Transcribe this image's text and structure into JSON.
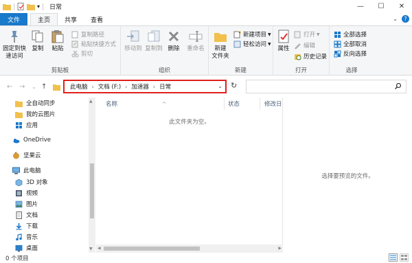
{
  "window": {
    "title": "日常",
    "controls": {
      "minimize": "—",
      "maximize": "☐",
      "close": "✕"
    }
  },
  "ribbon_tabs": [
    {
      "label": "文件"
    },
    {
      "label": "主页"
    },
    {
      "label": "共享"
    },
    {
      "label": "查看"
    }
  ],
  "ribbon": {
    "clipboard": {
      "label": "剪贴板",
      "pin": "固定到快\n速访问",
      "copy": "复制",
      "paste": "粘贴",
      "copy_path": "复制路径",
      "paste_shortcut": "粘贴快捷方式",
      "cut": "剪切"
    },
    "organize": {
      "label": "组织",
      "move_to": "移动到",
      "copy_to": "复制到",
      "delete": "删除",
      "rename": "重命名"
    },
    "new": {
      "label": "新建",
      "new_folder": "新建\n文件夹",
      "new_item": "新建项目",
      "easy_access": "轻松访问"
    },
    "open": {
      "label": "打开",
      "properties": "属性",
      "open": "打开",
      "edit": "编辑",
      "history": "历史记录"
    },
    "select": {
      "label": "选择",
      "select_all": "全部选择",
      "select_none": "全部取消",
      "invert": "反向选择"
    }
  },
  "address": {
    "crumbs": [
      "此电脑",
      "文档 (F:)",
      "加速器",
      "日常"
    ],
    "dropdown_glyph": "⌄",
    "refresh_glyph": "↻"
  },
  "nav_glyphs": {
    "back": "←",
    "forward": "→",
    "recent": "⌄",
    "up": "↑"
  },
  "navpane": {
    "items": [
      {
        "label": "全自动同步",
        "icon": "folder-icon"
      },
      {
        "label": "我的云图片",
        "icon": "folder-icon"
      },
      {
        "label": "应用",
        "icon": "apps-icon"
      },
      {
        "label": "OneDrive",
        "icon": "cloud-icon"
      },
      {
        "label": "坚果云",
        "icon": "nut-icon"
      },
      {
        "label": "此电脑",
        "icon": "computer-icon"
      },
      {
        "label": "3D 对象",
        "icon": "cube-icon"
      },
      {
        "label": "视频",
        "icon": "video-icon"
      },
      {
        "label": "图片",
        "icon": "picture-icon"
      },
      {
        "label": "文档",
        "icon": "document-icon"
      },
      {
        "label": "下载",
        "icon": "download-icon"
      },
      {
        "label": "音乐",
        "icon": "music-icon"
      },
      {
        "label": "桌面",
        "icon": "desktop-icon"
      }
    ]
  },
  "filelist": {
    "columns": [
      "名称",
      "状态",
      "修改日"
    ],
    "sort_glyph": "^",
    "empty_text": "此文件夹为空。"
  },
  "preview": {
    "text": "选择要预览的文件。"
  },
  "status": {
    "count": "0 个项目"
  },
  "colors": {
    "accent": "#1979ca",
    "highlight": "#e0201b",
    "folder": "#f2c04c"
  }
}
